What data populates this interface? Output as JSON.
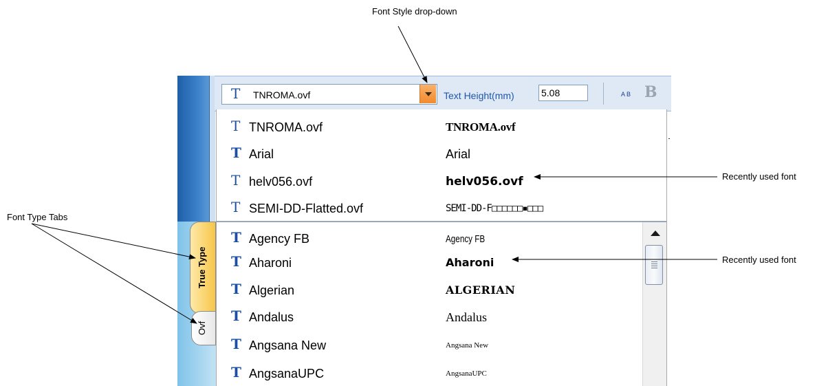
{
  "callouts": {
    "font_style": "Font Style drop-down",
    "font_type_tabs": "Font Type Tabs",
    "recently_used_1": "Recently used font",
    "recently_used_2": "Recently used font"
  },
  "tabs": {
    "truetype": "True Type",
    "ovf": "Ovf"
  },
  "toolbar": {
    "font_combo_value": "TNROMA.ovf",
    "text_height_label": "Text Height(mm)",
    "text_height_value": "5.08",
    "ab_icon_text": "A B",
    "bold_label": "B"
  },
  "recent_fonts": [
    {
      "name": "TNROMA.ovf",
      "type": "ovf",
      "preview": "TNROMA.ovf"
    },
    {
      "name": "Arial",
      "type": "truetype",
      "preview": "Arial"
    },
    {
      "name": "helv056.ovf",
      "type": "ovf",
      "preview": "helv056.ovf"
    },
    {
      "name": "SEMI-DD-Flatted.ovf",
      "type": "ovf",
      "preview": "SEMI-DD-F□□□□□□▪□□□"
    }
  ],
  "fonts": [
    {
      "name": "Agency FB",
      "type": "truetype",
      "preview": "Agency FB"
    },
    {
      "name": "Aharoni",
      "type": "truetype",
      "preview": "Aharoni"
    },
    {
      "name": "Algerian",
      "type": "truetype",
      "preview": "ALGERIAN"
    },
    {
      "name": "Andalus",
      "type": "truetype",
      "preview": "Andalus"
    },
    {
      "name": "Angsana New",
      "type": "truetype",
      "preview": "Angsana New"
    },
    {
      "name": "AngsanaUPC",
      "type": "truetype",
      "preview": "AngsanaUPC"
    }
  ],
  "glyphs": {
    "ovf": "T",
    "truetype": "T"
  }
}
